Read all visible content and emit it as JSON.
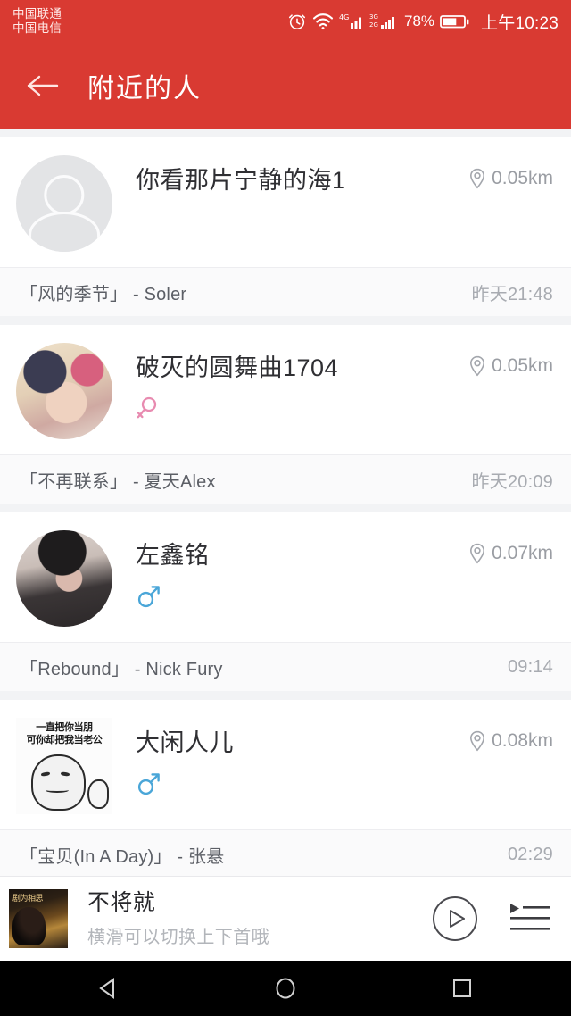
{
  "status_bar": {
    "carrier_line1": "中国联通",
    "carrier_line2": "中国电信",
    "battery_percent": "78%",
    "clock": "上午10:23",
    "icons": [
      "alarm-icon",
      "wifi-icon",
      "signal-4g-icon",
      "signal-3g-2g-icon",
      "battery-icon"
    ]
  },
  "header": {
    "title": "附近的人",
    "back_label": "←",
    "bg_color": "#d93a32"
  },
  "colors": {
    "accent_red": "#d93a32",
    "male_blue": "#4aa6d8",
    "female_pink": "#e88bb0",
    "page_bg": "#f2f3f5"
  },
  "people": [
    {
      "name": "你看那片宁静的海1",
      "distance": "0.05km",
      "gender": "",
      "avatar_type": "placeholder",
      "song": "「风的季节」 - Soler",
      "time": "昨天21:48"
    },
    {
      "name": "破灭的圆舞曲1704",
      "distance": "0.05km",
      "gender": "female",
      "avatar_type": "photo-girl",
      "song": "「不再联系」 - 夏天Alex",
      "time": "昨天20:09"
    },
    {
      "name": "左鑫铭",
      "distance": "0.07km",
      "gender": "male",
      "avatar_type": "photo-boy",
      "song": "「Rebound」 - Nick Fury",
      "time": "09:14"
    },
    {
      "name": "大闲人儿",
      "distance": "0.08km",
      "gender": "male",
      "avatar_type": "meme",
      "avatar_text_line1": "一直把你当朋",
      "avatar_text_line2": "可你却把我当老公",
      "song": "「宝贝(In A Day)」 - 张悬",
      "time": "02:29"
    }
  ],
  "player": {
    "title": "不将就",
    "subtitle": "横滑可以切换上下首哦",
    "play_icon": "play-icon",
    "playlist_icon": "playlist-icon"
  },
  "nav_bar": {
    "back": "back-triangle-icon",
    "home": "home-circle-icon",
    "recents": "recents-square-icon"
  }
}
